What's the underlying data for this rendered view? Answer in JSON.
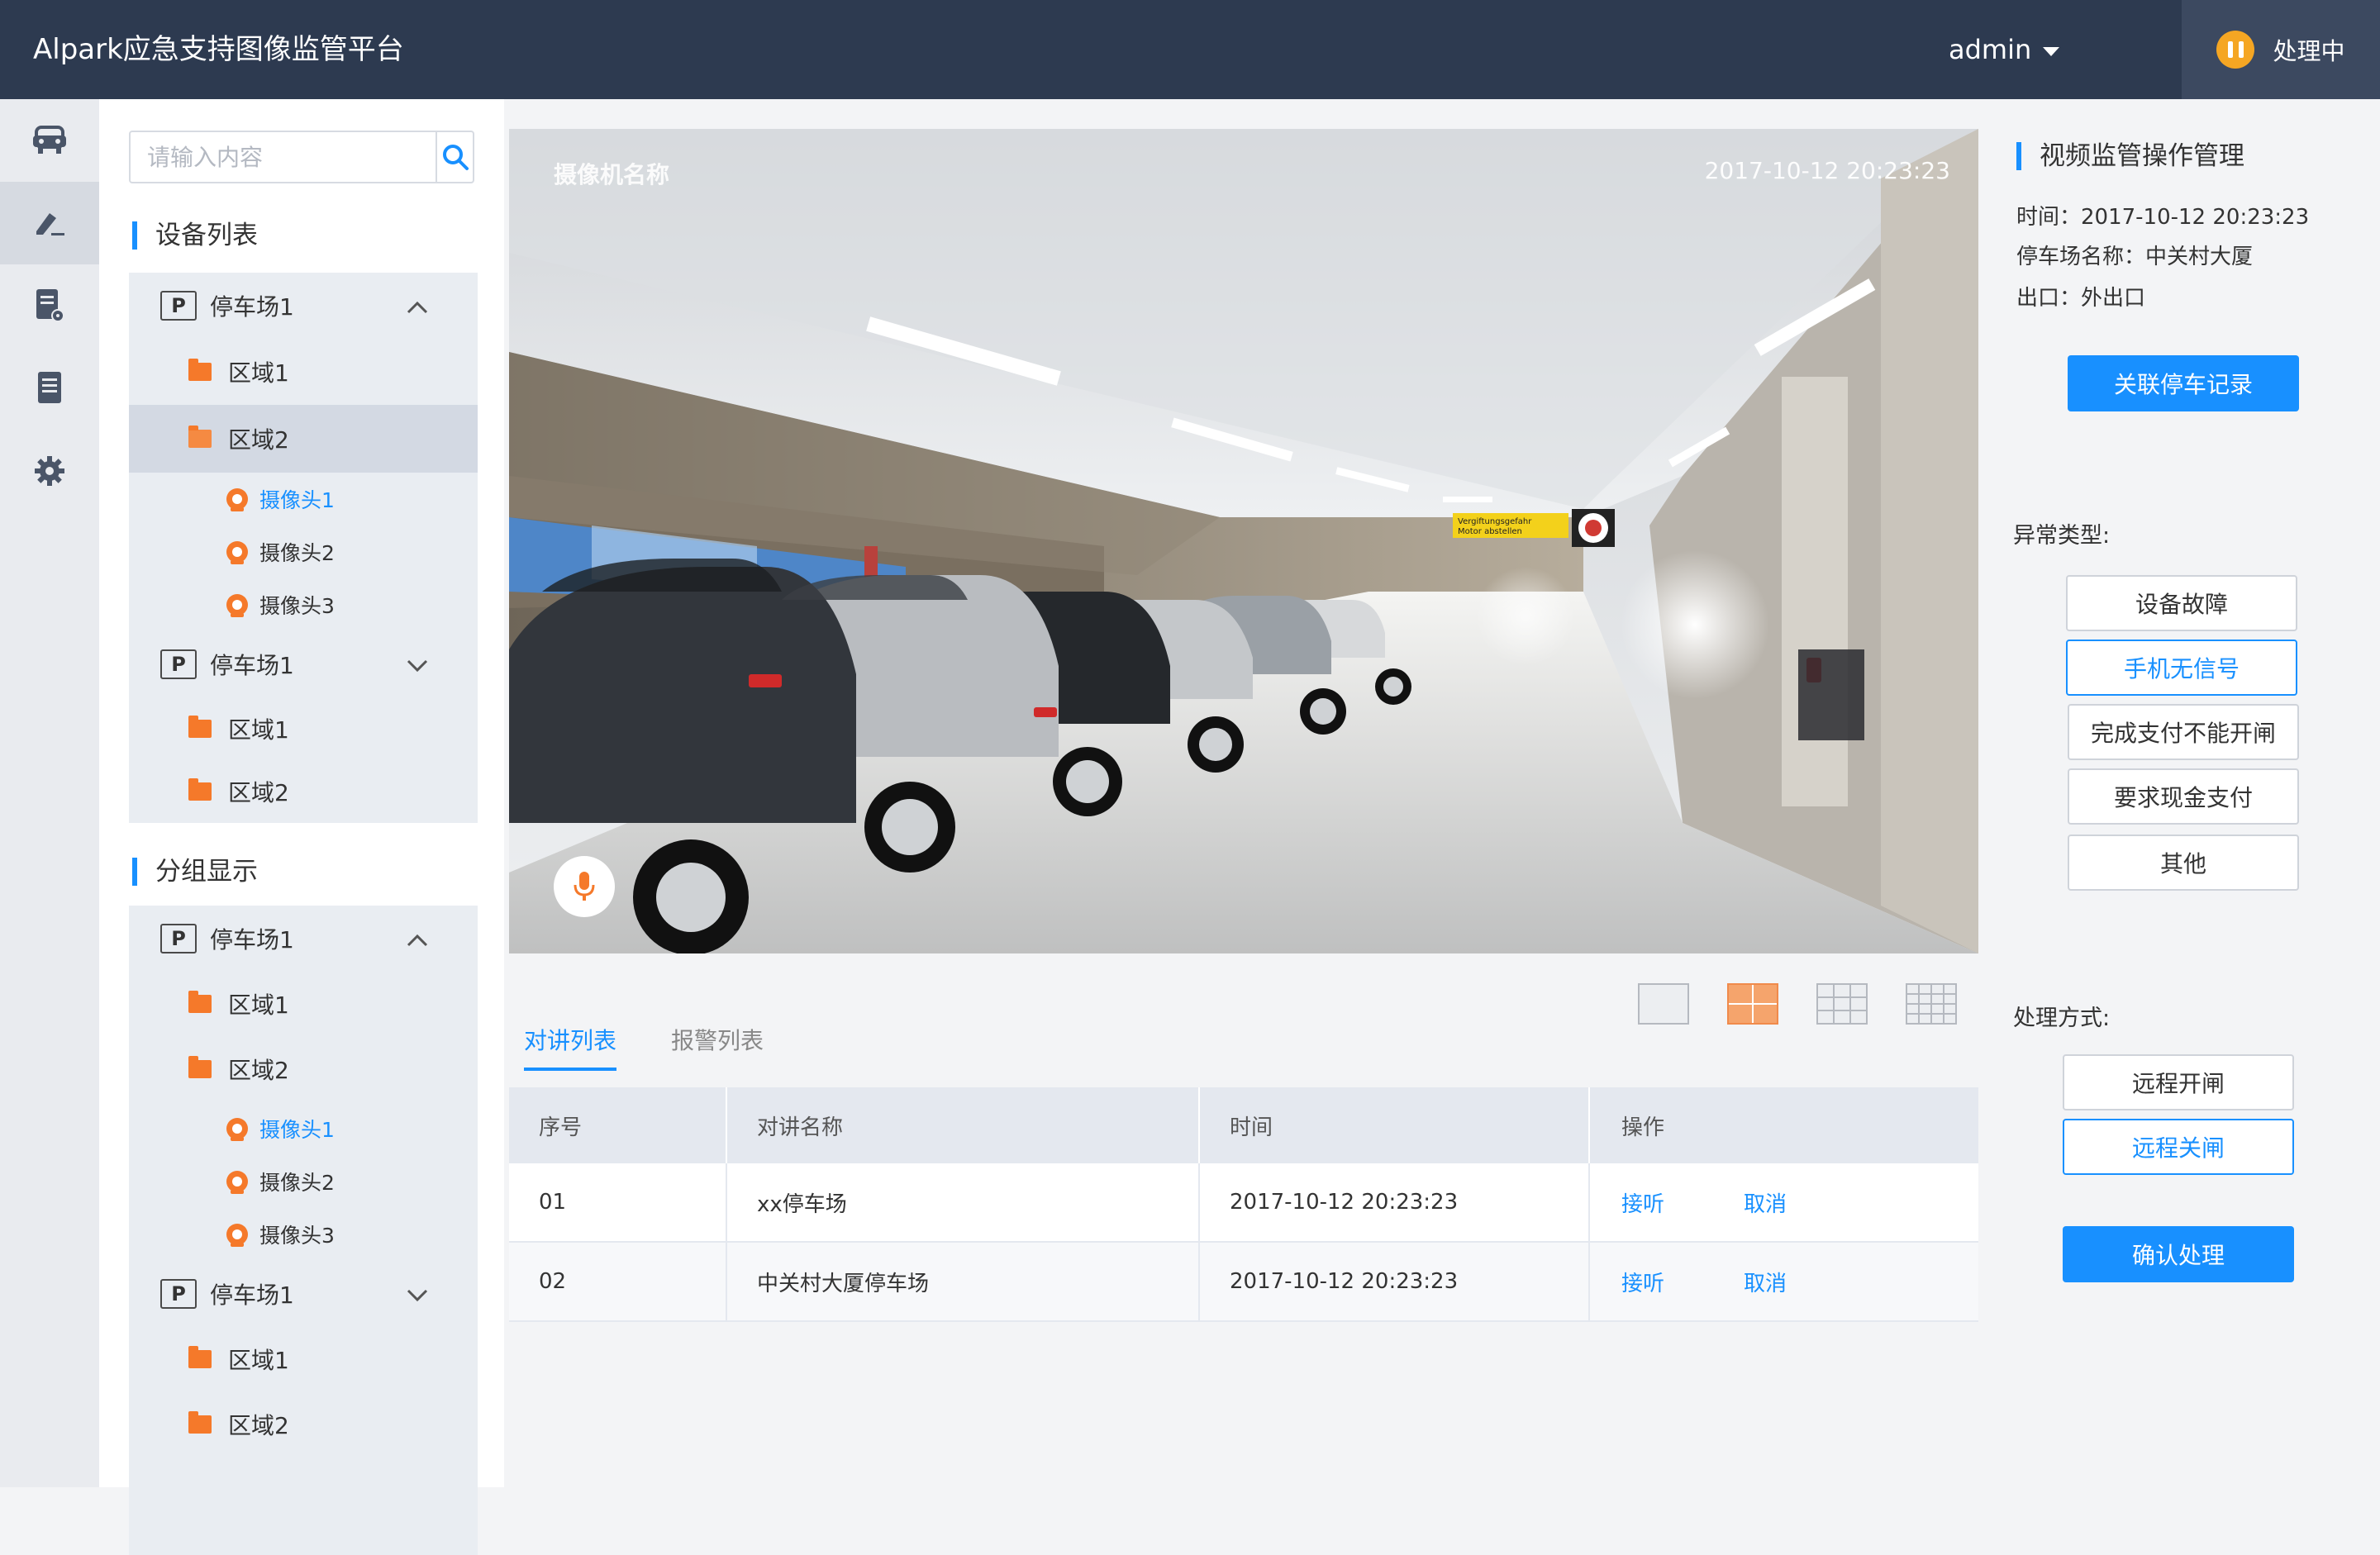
{
  "header": {
    "title": "Alpark应急支持图像监管平台",
    "user": "admin",
    "status": "处理中"
  },
  "sidenav": {
    "items": [
      {
        "icon": "car-icon"
      },
      {
        "icon": "edit-icon",
        "active": true
      },
      {
        "icon": "document-settings-icon"
      },
      {
        "icon": "document-list-icon"
      },
      {
        "icon": "gear-icon"
      }
    ]
  },
  "search": {
    "placeholder": "请输入内容"
  },
  "device_list": {
    "title": "设备列表",
    "items": [
      {
        "type": "lot",
        "label": "停车场1",
        "expanded": true
      },
      {
        "type": "area",
        "label": "区域1"
      },
      {
        "type": "area",
        "label": "区域2",
        "selected": true
      },
      {
        "type": "camera",
        "label": "摄像头1",
        "highlight": true
      },
      {
        "type": "camera",
        "label": "摄像头2"
      },
      {
        "type": "camera",
        "label": "摄像头3"
      },
      {
        "type": "lot",
        "label": "停车场1",
        "expanded": false
      },
      {
        "type": "area",
        "label": "区域1"
      },
      {
        "type": "area",
        "label": "区域2"
      }
    ]
  },
  "group_display": {
    "title": "分组显示",
    "items": [
      {
        "type": "lot",
        "label": "停车场1",
        "expanded": true
      },
      {
        "type": "area",
        "label": "区域1"
      },
      {
        "type": "area",
        "label": "区域2"
      },
      {
        "type": "camera",
        "label": "摄像头1",
        "highlight": true
      },
      {
        "type": "camera",
        "label": "摄像头2"
      },
      {
        "type": "camera",
        "label": "摄像头3"
      },
      {
        "type": "lot",
        "label": "停车场1",
        "expanded": false
      },
      {
        "type": "area",
        "label": "区域1"
      },
      {
        "type": "area",
        "label": "区域2"
      }
    ]
  },
  "video": {
    "camera_name": "摄像机名称",
    "timestamp": "2017-10-12   20:23:23",
    "sign_text_1": "Vergiftungsgefahr",
    "sign_text_2": "Motor abstellen"
  },
  "tabs": [
    {
      "label": "对讲列表",
      "active": true
    },
    {
      "label": "报警列表",
      "active": false
    }
  ],
  "table": {
    "headers": [
      "序号",
      "对讲名称",
      "时间",
      "操作"
    ],
    "rows": [
      {
        "no": "01",
        "name": "xx停车场",
        "time": "2017-10-12   20:23:23",
        "answer": "接听",
        "cancel": "取消"
      },
      {
        "no": "02",
        "name": "中关村大厦停车场",
        "time": "2017-10-12   20:23:23",
        "answer": "接听",
        "cancel": "取消"
      }
    ]
  },
  "panel": {
    "title": "视频监管操作管理",
    "time": "时间：2017-10-12   20:23:23",
    "lot": "停车场名称：中关村大厦",
    "exit": "出口：外出口",
    "link_button": "关联停车记录",
    "abnormal_label": "异常类型:",
    "abnormal_types": [
      {
        "label": "设备故障",
        "selected": false
      },
      {
        "label": "手机无信号",
        "selected": true
      },
      {
        "label": "完成支付不能开闸",
        "selected": false
      },
      {
        "label": "要求现金支付",
        "selected": false
      },
      {
        "label": "其他",
        "selected": false
      }
    ],
    "handle_label": "处理方式:",
    "handle_methods": [
      {
        "label": "远程开闸",
        "selected": false
      },
      {
        "label": "远程关闸",
        "selected": true
      }
    ],
    "confirm_button": "确认处理"
  },
  "colors": {
    "header_bg": "#2d3a50",
    "accent": "#1890ff",
    "orange": "#f5792a",
    "status_yellow": "#f5a623"
  }
}
